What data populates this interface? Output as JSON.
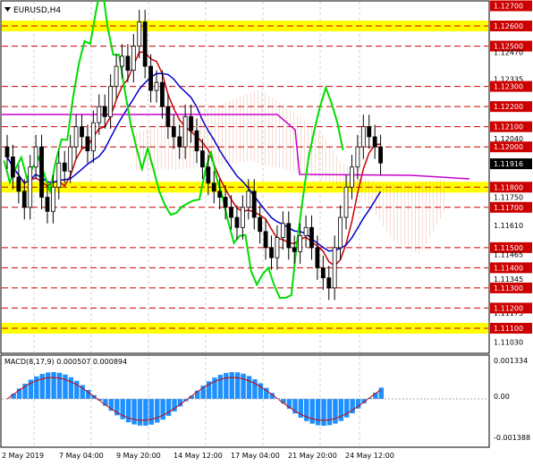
{
  "symbol": "EURUSD,H4",
  "price_axis": [
    {
      "label": "1.12700",
      "value": 1.127,
      "highlight": true
    },
    {
      "label": "1.12600",
      "value": 1.126,
      "highlight": true
    },
    {
      "label": "1.12500",
      "value": 1.125,
      "highlight": true
    },
    {
      "label": "1.12470",
      "value": 1.1247,
      "highlight": false
    },
    {
      "label": "1.12335",
      "value": 1.12335,
      "highlight": false
    },
    {
      "label": "1.12300",
      "value": 1.123,
      "highlight": true
    },
    {
      "label": "1.12200",
      "value": 1.122,
      "highlight": true
    },
    {
      "label": "1.12100",
      "value": 1.121,
      "highlight": true
    },
    {
      "label": "1.12040",
      "value": 1.1204,
      "highlight": false
    },
    {
      "label": "1.12000",
      "value": 1.12,
      "highlight": true
    },
    {
      "label": "1.11916",
      "value": 1.11916,
      "highlight": false,
      "current": true
    },
    {
      "label": "1.11800",
      "value": 1.118,
      "highlight": true
    },
    {
      "label": "1.11750",
      "value": 1.1175,
      "highlight": false
    },
    {
      "label": "1.11700",
      "value": 1.117,
      "highlight": true
    },
    {
      "label": "1.11610",
      "value": 1.1161,
      "highlight": false
    },
    {
      "label": "1.11500",
      "value": 1.115,
      "highlight": true
    },
    {
      "label": "1.11465",
      "value": 1.11465,
      "highlight": false
    },
    {
      "label": "1.11400",
      "value": 1.114,
      "highlight": true
    },
    {
      "label": "1.11345",
      "value": 1.11345,
      "highlight": false
    },
    {
      "label": "1.11300",
      "value": 1.113,
      "highlight": true
    },
    {
      "label": "1.11175",
      "value": 1.11175,
      "highlight": false
    },
    {
      "label": "1.11200",
      "value": 1.112,
      "highlight": true
    },
    {
      "label": "1.11100",
      "value": 1.111,
      "highlight": true
    },
    {
      "label": "1.11030",
      "value": 1.1103,
      "highlight": false
    }
  ],
  "resistance_lines": [
    1.125,
    1.123,
    1.122,
    1.121,
    1.12,
    1.117,
    1.115,
    1.114,
    1.113,
    1.112
  ],
  "yellow_zones": [
    1.126,
    1.118,
    1.111
  ],
  "time_labels": [
    "2 May 2019",
    "7 May 04:00",
    "9 May 20:00",
    "14 May 12:00",
    "17 May 04:00",
    "21 May 20:00",
    "24 May 12:00"
  ],
  "macd": {
    "title": "MACD(8,17,9) 0.000507 0.000894",
    "axis": [
      "0.001334",
      "0.00",
      "-0.001388"
    ]
  },
  "colors": {
    "bull": "#000000",
    "bear": "#000000",
    "tenkan": "#cc0000",
    "kijun": "#0000cc",
    "chikou": "#00dd00",
    "senkou_a": "#d2691e",
    "senkou_b": "#cc00cc",
    "yellow": "#ffff00",
    "red_line": "#cc0000",
    "macd_hist": "#1e90ff"
  },
  "chart_data": {
    "type": "candlestick",
    "symbol": "EURUSD",
    "timeframe": "H4",
    "ylim": [
      1.1098,
      1.1272
    ],
    "x_ticks": [
      "2 May 2019",
      "7 May 04:00",
      "9 May 20:00",
      "14 May 12:00",
      "17 May 04:00",
      "21 May 20:00",
      "24 May 12:00"
    ],
    "close": [
      1.1195,
      1.1185,
      1.1178,
      1.117,
      1.119,
      1.12,
      1.1175,
      1.1168,
      1.118,
      1.1192,
      1.1188,
      1.12,
      1.121,
      1.1205,
      1.1198,
      1.1212,
      1.122,
      1.1215,
      1.123,
      1.124,
      1.1245,
      1.1238,
      1.125,
      1.1262,
      1.124,
      1.1228,
      1.1232,
      1.122,
      1.121,
      1.1205,
      1.12,
      1.1215,
      1.1208,
      1.1198,
      1.119,
      1.1182,
      1.1178,
      1.1175,
      1.117,
      1.1165,
      1.116,
      1.117,
      1.1178,
      1.1165,
      1.1158,
      1.115,
      1.1145,
      1.1155,
      1.1162,
      1.115,
      1.1148,
      1.1156,
      1.116,
      1.115,
      1.114,
      1.1135,
      1.113,
      1.115,
      1.1165,
      1.118,
      1.119,
      1.12,
      1.121,
      1.1205,
      1.12,
      1.1192
    ],
    "macd_value": 0.000507,
    "macd_signal": 0.000894,
    "current_price": 1.11916
  }
}
